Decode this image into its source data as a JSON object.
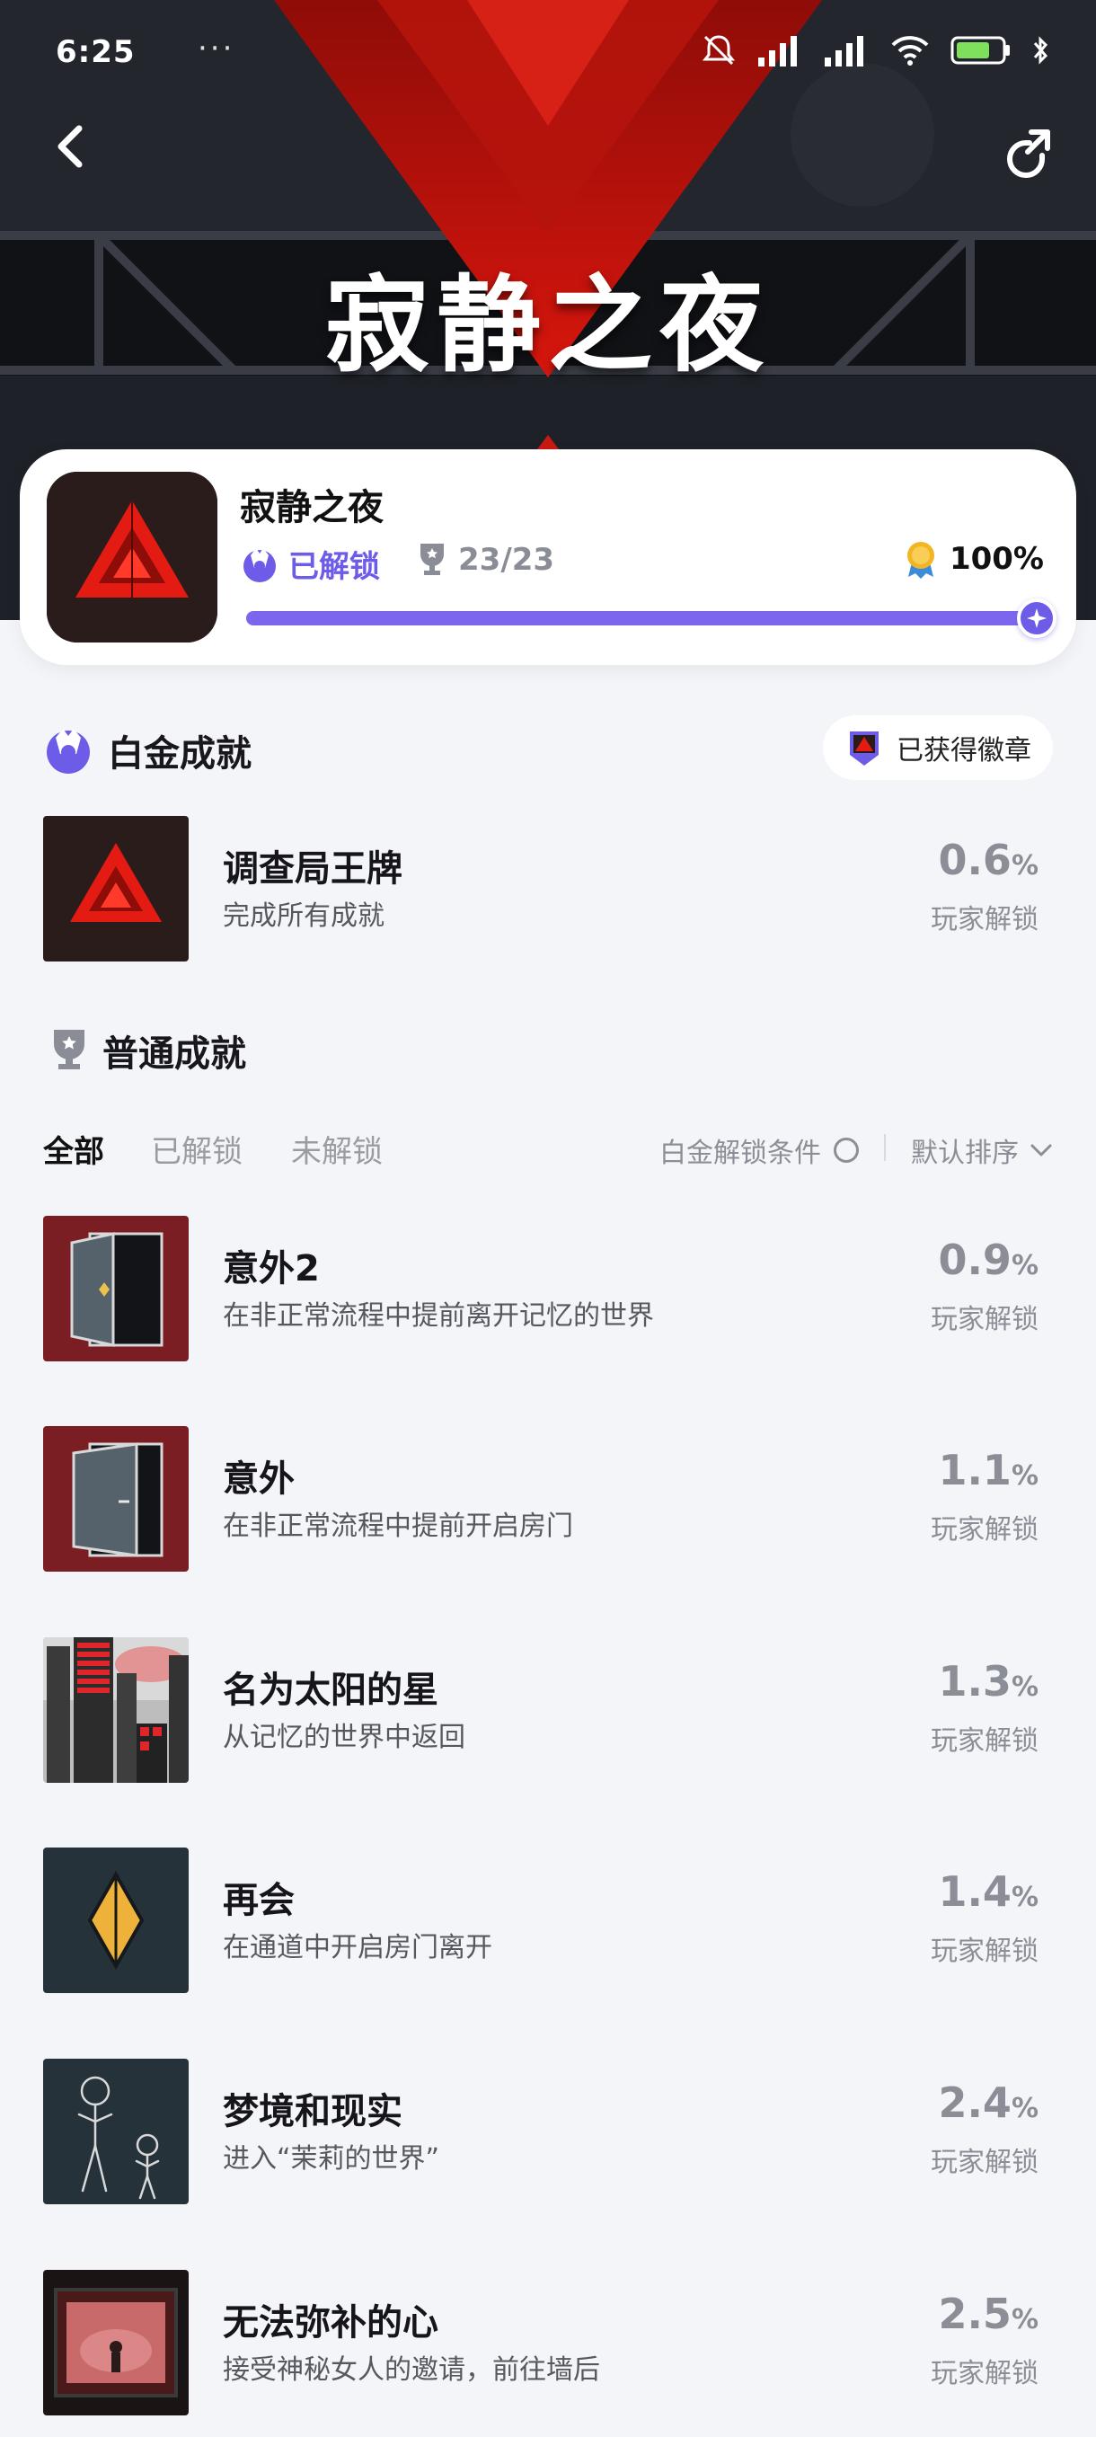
{
  "status_bar": {
    "time": "6:25",
    "dots": "···"
  },
  "hero": {
    "title": "寂静之夜"
  },
  "game": {
    "name": "寂静之夜",
    "unlock_label": "已解锁",
    "trophy_count": "23/23",
    "percent_label": "100%",
    "progress": 1.0
  },
  "platinum": {
    "heading": "白金成就",
    "badge_chip": "已获得徽章",
    "item": {
      "title": "调查局王牌",
      "desc": "完成所有成就",
      "pct": "0.6",
      "pct_unit": "%",
      "sub": "玩家解锁"
    }
  },
  "normal": {
    "heading": "普通成就",
    "tabs": [
      "全部",
      "已解锁",
      "未解锁"
    ],
    "active_tab": "全部",
    "condition_label": "白金解锁条件",
    "sort_label": "默认排序",
    "items": [
      {
        "title": "意外2",
        "desc": "在非正常流程中提前离开记忆的世界",
        "pct": "0.9",
        "pct_unit": "%",
        "sub": "玩家解锁",
        "icon": "open-door-icon"
      },
      {
        "title": "意外",
        "desc": "在非正常流程中提前开启房门",
        "pct": "1.1",
        "pct_unit": "%",
        "sub": "玩家解锁",
        "icon": "door-icon"
      },
      {
        "title": "名为太阳的星",
        "desc": "从记忆的世界中返回",
        "pct": "1.3",
        "pct_unit": "%",
        "sub": "玩家解锁",
        "icon": "city-icon"
      },
      {
        "title": "再会",
        "desc": "在通道中开启房门离开",
        "pct": "1.4",
        "pct_unit": "%",
        "sub": "玩家解锁",
        "icon": "diamond-icon"
      },
      {
        "title": "梦境和现实",
        "desc": "进入“茉莉的世界”",
        "pct": "2.4",
        "pct_unit": "%",
        "sub": "玩家解锁",
        "icon": "sketch-figures-icon"
      },
      {
        "title": "无法弥补的心",
        "desc": "接受神秘女人的邀请，前往墙后",
        "pct": "2.5",
        "pct_unit": "%",
        "sub": "玩家解锁",
        "icon": "red-window-icon"
      }
    ]
  },
  "colors": {
    "accent": "#6d5ce7",
    "page_bg": "#f4f5f8",
    "hero_bg": "#1d1f26",
    "brand_red": "#c81a12"
  }
}
